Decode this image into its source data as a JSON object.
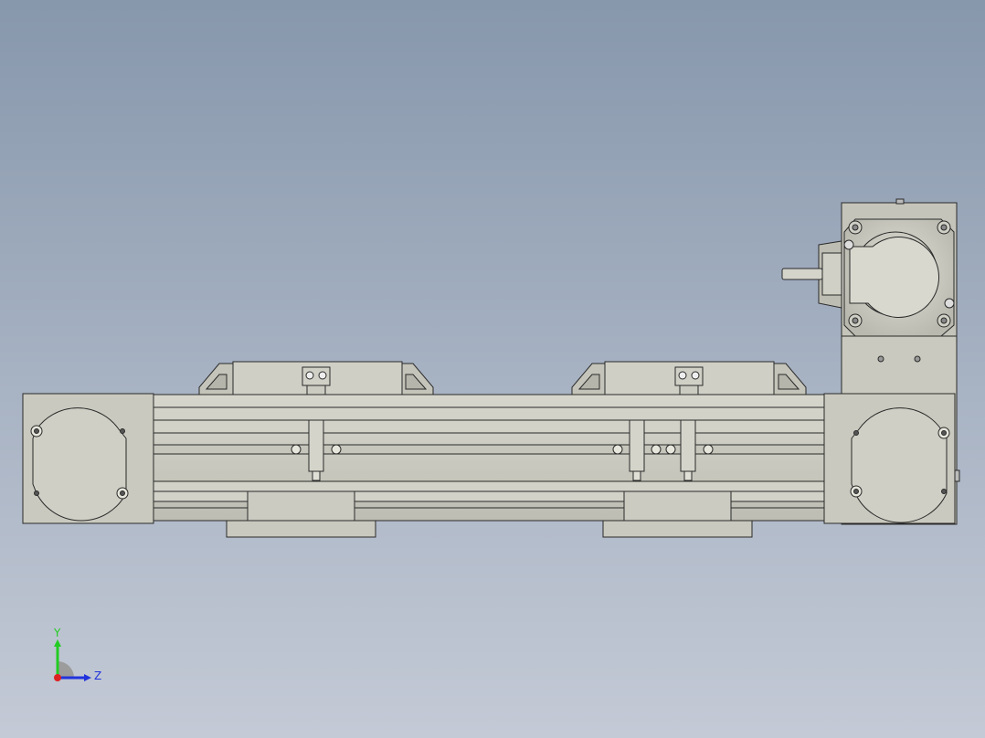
{
  "viewport": {
    "background_top": "#8797ac",
    "background_bottom": "#c4cad6",
    "part_fill": "#c9c9bf",
    "part_shade": "#b7b7ad",
    "edge_color": "#2a2a2a"
  },
  "triad": {
    "y_label": "Y",
    "z_label": "Z",
    "y_color": "#22cc22",
    "z_color": "#2233dd",
    "x_color": "#dd2222"
  }
}
